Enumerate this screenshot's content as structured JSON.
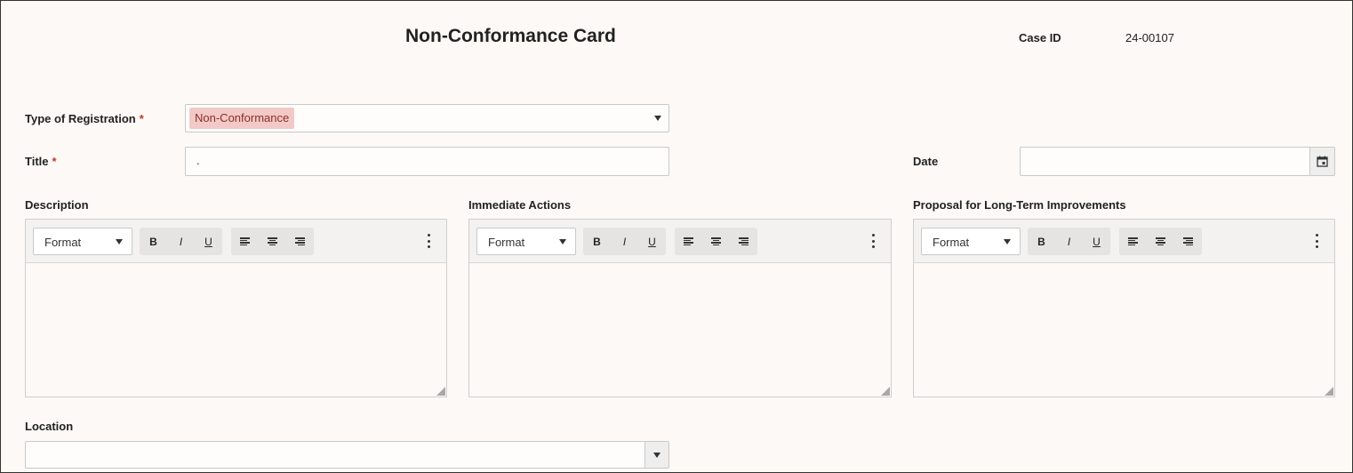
{
  "header": {
    "title": "Non-Conformance Card",
    "case_id_label": "Case ID",
    "case_id_value": "24-00107"
  },
  "form": {
    "type_label": "Type of Registration",
    "type_value": "Non-Conformance",
    "title_label": "Title",
    "title_value": ".",
    "date_label": "Date",
    "date_value": "",
    "required_mark": "*",
    "location_label": "Location",
    "location_value": ""
  },
  "editors": [
    {
      "label": "Description",
      "format_label": "Format"
    },
    {
      "label": "Immediate Actions",
      "format_label": "Format"
    },
    {
      "label": "Proposal for Long-Term Improvements",
      "format_label": "Format"
    }
  ],
  "toolbar_buttons": {
    "bold": "B",
    "italic": "I",
    "underline": "U"
  },
  "icons": {
    "calendar": "calendar-icon",
    "dropdown": "chevron-down-icon",
    "more": "more-vertical-icon",
    "align_left": "align-left-icon",
    "align_center": "align-center-icon",
    "align_right": "align-right-icon",
    "resize": "resize-handle-icon"
  },
  "colors": {
    "background": "#fdf9f6",
    "tag_bg": "#f2c9c6",
    "tag_text": "#8c2f2a",
    "required": "#c0392b"
  }
}
